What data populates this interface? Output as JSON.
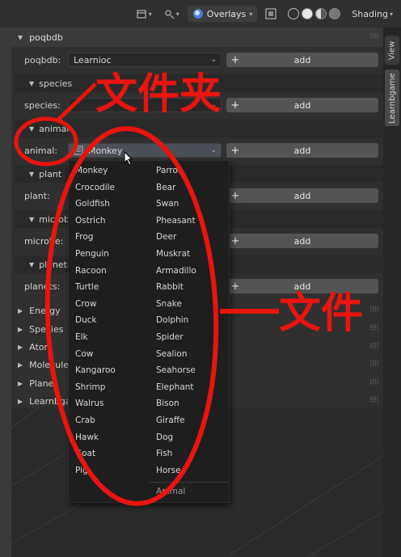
{
  "header": {
    "overlays_label": "Overlays",
    "shading_label": "Shading"
  },
  "tabs": {
    "view": "View",
    "learnbgame": "Learnbgame"
  },
  "panel": {
    "title": "poqbdb",
    "rows": [
      {
        "label": "poqbdb:",
        "value": "Learnioc",
        "add": "add"
      }
    ],
    "sections": [
      {
        "title": "species",
        "label": "species:",
        "value": "",
        "add": "add"
      },
      {
        "title": "animal",
        "label": "animal:",
        "value": "Monkey",
        "add": "add"
      },
      {
        "title": "plant",
        "label": "plant:",
        "value": "",
        "add": "add"
      },
      {
        "title": "microbe",
        "label": "microbe:",
        "value": "",
        "add": "add"
      },
      {
        "title": "planets",
        "label": "planets:",
        "value": "",
        "add": "add"
      }
    ],
    "collapsed": [
      "Energy",
      "Species",
      "Atom",
      "Molecule",
      "Planet",
      "Learnbga"
    ]
  },
  "dropdown": {
    "col1": [
      "Monkey",
      "Crocodile",
      "Goldfish",
      "Ostrich",
      "Frog",
      "Penguin",
      "Racoon",
      "Turtle",
      "Crow",
      "Duck",
      "Elk",
      "Cow",
      "Kangaroo",
      "Shrimp",
      "Walrus",
      "Crab",
      "Hawk",
      "Goat",
      "Pig"
    ],
    "col2": [
      "Parrot",
      "Bear",
      "Swan",
      "Pheasant",
      "Deer",
      "Muskrat",
      "Armadillo",
      "Rabbit",
      "Snake",
      "Dolphin",
      "Spider",
      "Sealion",
      "Seahorse",
      "Elephant",
      "Bison",
      "Giraffe",
      "Dog",
      "Fish",
      "Horse"
    ],
    "footer": "Animal"
  },
  "annotations": {
    "folder": "文件夹",
    "file": "文件"
  },
  "colors": {
    "annotation_red": "#e8140f"
  }
}
